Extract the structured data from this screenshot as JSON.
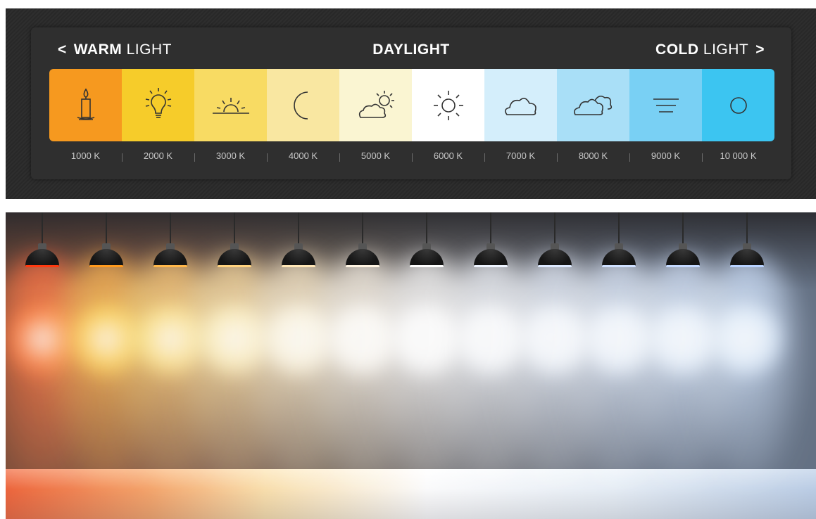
{
  "header": {
    "left_bold": "WARM",
    "left_light": "LIGHT",
    "left_chevron": "<",
    "center": "DAYLIGHT",
    "right_bold": "COLD",
    "right_light": "LIGHT",
    "right_chevron": ">"
  },
  "scale": [
    {
      "label": "1000 K",
      "color": "#f6991f",
      "icon": "candle-icon"
    },
    {
      "label": "2000 K",
      "color": "#f6cc2a",
      "icon": "lightbulb-icon"
    },
    {
      "label": "3000 K",
      "color": "#f8db63",
      "icon": "sunrise-icon"
    },
    {
      "label": "4000 K",
      "color": "#f9e7a1",
      "icon": "moon-icon"
    },
    {
      "label": "5000 K",
      "color": "#faf5d2",
      "icon": "partly-cloudy-icon"
    },
    {
      "label": "6000 K",
      "color": "#ffffff",
      "icon": "sun-icon"
    },
    {
      "label": "7000 K",
      "color": "#d4eefb",
      "icon": "cloud-icon"
    },
    {
      "label": "8000 K",
      "color": "#a9dff7",
      "icon": "clouds-icon"
    },
    {
      "label": "9000 K",
      "color": "#79d0f4",
      "icon": "fog-icon"
    },
    {
      "label": "10 000 K",
      "color": "#3cc5f1",
      "icon": "circle-icon"
    }
  ],
  "lamp_colors": [
    "#ff3a10",
    "#ff9a1e",
    "#ffb74a",
    "#ffd27e",
    "#ffe6b6",
    "#fff4e2",
    "#ffffff",
    "#eef4ff",
    "#dde9ff",
    "#cfe0ff",
    "#c4d9ff",
    "#b8d2ff"
  ]
}
